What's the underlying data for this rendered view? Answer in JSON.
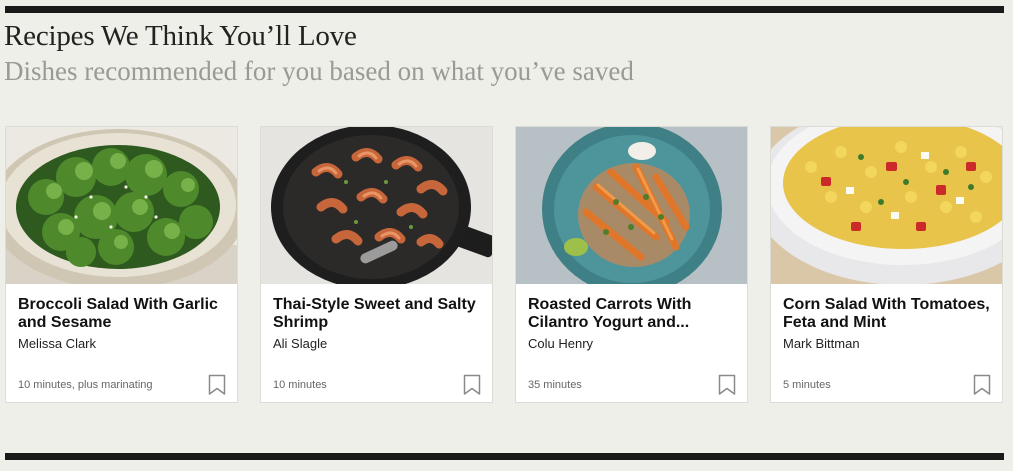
{
  "section": {
    "title": "Recipes We Think You’ll Love",
    "subtitle": "Dishes recommended for you based on what you’ve saved"
  },
  "recipes": [
    {
      "title": "Broccoli Salad With Garlic and Sesame",
      "author": "Melissa Clark",
      "time": "10 minutes, plus marinating",
      "image_icon": "broccoli-salad-photo"
    },
    {
      "title": "Thai-Style Sweet and Salty Shrimp",
      "author": "Ali Slagle",
      "time": "10 minutes",
      "image_icon": "shrimp-skillet-photo"
    },
    {
      "title": "Roasted Carrots With Cilantro Yogurt and...",
      "author": "Colu Henry",
      "time": "35 minutes",
      "image_icon": "roasted-carrots-photo"
    },
    {
      "title": "Corn Salad With Tomatoes, Feta and Mint",
      "author": "Mark Bittman",
      "time": "5 minutes",
      "image_icon": "corn-salad-photo"
    }
  ],
  "icons": {
    "save": "bookmark-icon"
  },
  "colors": {
    "background": "#efefea",
    "rule": "#1a1a1a",
    "subtitle": "#9a9a95"
  }
}
